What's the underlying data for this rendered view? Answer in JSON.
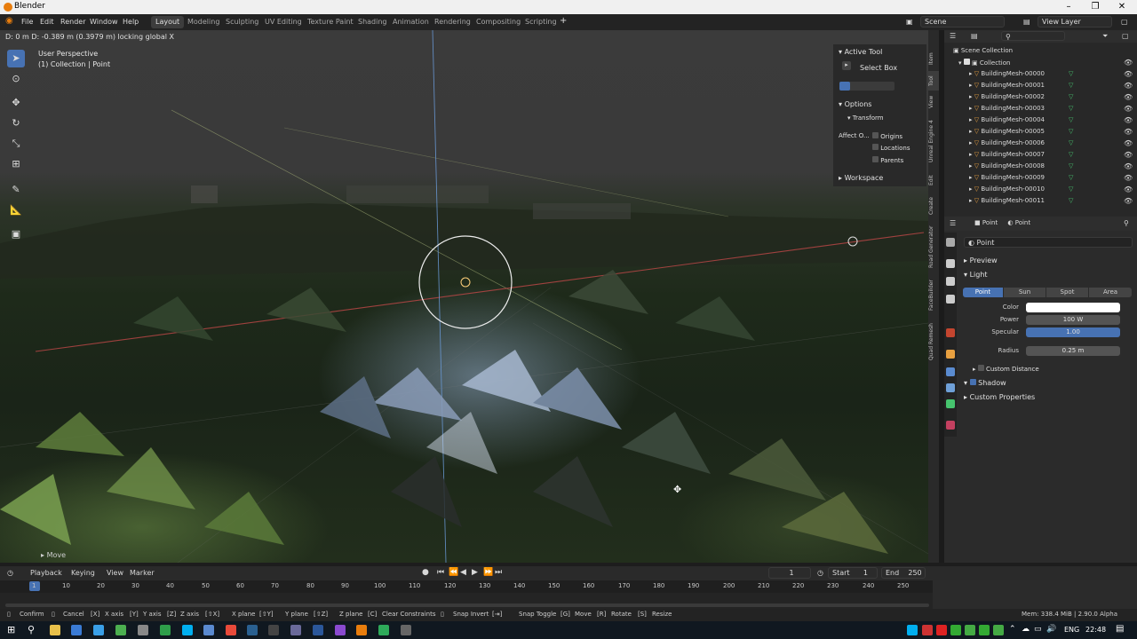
{
  "window": {
    "title": "Blender"
  },
  "menu": {
    "file": "File",
    "edit": "Edit",
    "render": "Render",
    "window": "Window",
    "help": "Help"
  },
  "workspaces": [
    "Layout",
    "Modeling",
    "Sculpting",
    "UV Editing",
    "Texture Paint",
    "Shading",
    "Animation",
    "Rendering",
    "Compositing",
    "Scripting"
  ],
  "scene": {
    "scene_name": "Scene",
    "view_layer": "View Layer"
  },
  "viewport": {
    "status": "D: 0 m   D: -0.389 m (0.3979 m) locking global X",
    "view_name": "User Perspective",
    "collection_info": "(1) Collection | Point",
    "last_op": "Move"
  },
  "npanel": {
    "active_tool": "Active Tool",
    "select_box": "Select Box",
    "options": "Options",
    "transform": "Transform",
    "affect_only": "Affect O...",
    "origins": "Origins",
    "locations": "Locations",
    "parents": "Parents",
    "workspace": "Workspace",
    "tabs": [
      "Item",
      "Tool",
      "View",
      "Unreal Engine 4",
      "Edit",
      "Create",
      "Road Generator",
      "FaceBuilder",
      "Quad Remesh"
    ]
  },
  "outliner": {
    "scene_collection": "Scene Collection",
    "collection": "Collection",
    "items": [
      "BuildingMesh-00000",
      "BuildingMesh-00001",
      "BuildingMesh-00002",
      "BuildingMesh-00003",
      "BuildingMesh-00004",
      "BuildingMesh-00005",
      "BuildingMesh-00006",
      "BuildingMesh-00007",
      "BuildingMesh-00008",
      "BuildingMesh-00009",
      "BuildingMesh-00010",
      "BuildingMesh-00011"
    ]
  },
  "properties": {
    "breadcrumb_obj": "Point",
    "breadcrumb_data": "Point",
    "name": "Point",
    "preview": "Preview",
    "light": "Light",
    "types": [
      "Point",
      "Sun",
      "Spot",
      "Area"
    ],
    "active_type": "Point",
    "color_label": "Color",
    "power_label": "Power",
    "power_value": "100 W",
    "specular_label": "Specular",
    "specular_value": "1.00",
    "radius_label": "Radius",
    "radius_value": "0.25 m",
    "custom_distance": "Custom Distance",
    "shadow": "Shadow",
    "custom_properties": "Custom Properties"
  },
  "timeline": {
    "playback": "Playback",
    "keying": "Keying",
    "view": "View",
    "marker": "Marker",
    "current_frame": "1",
    "start_label": "Start",
    "start": "1",
    "end_label": "End",
    "end": "250",
    "ticks": [
      "1",
      "10",
      "20",
      "30",
      "40",
      "50",
      "60",
      "70",
      "80",
      "90",
      "100",
      "110",
      "120",
      "130",
      "140",
      "150",
      "160",
      "170",
      "180",
      "190",
      "200",
      "210",
      "220",
      "230",
      "240",
      "250"
    ]
  },
  "statusbar": {
    "items": [
      "Confirm",
      "Cancel",
      "X axis",
      "Y axis",
      "Z axis",
      "X plane",
      "Y plane",
      "Z plane",
      "Clear Constraints",
      "Snap Invert",
      "Snap Toggle",
      "Move",
      "Rotate",
      "Resize"
    ],
    "memory": "Mem: 338.4 MiB | 2.90.0 Alpha"
  },
  "taskbar": {
    "lang": "ENG",
    "time": "22:48"
  },
  "colors": {
    "accent": "#4772b3",
    "tri_orange": "#e8a040",
    "mesh_green": "#46c46e"
  }
}
